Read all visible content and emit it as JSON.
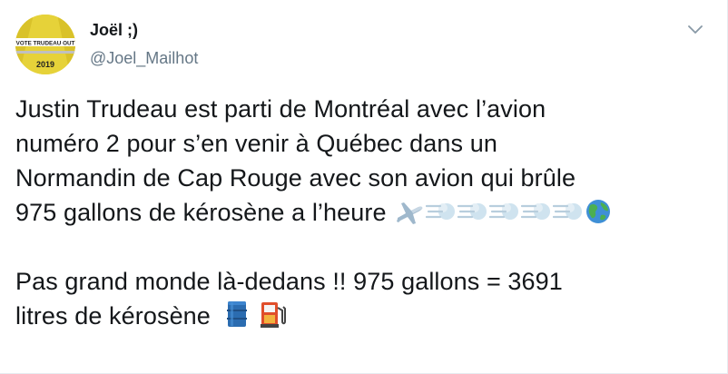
{
  "author": {
    "name": "Joël ;)",
    "handle": "@Joel_Mailhot",
    "avatar_badge_text": "VOTE TRUDEAU OUT",
    "avatar_year": "2019"
  },
  "menu": {
    "icon": "chevron-down-icon"
  },
  "tweet": {
    "paragraph1": [
      "Justin Trudeau est parti de Montréal avec l’avion",
      "numéro 2 pour s’en venir à Québec dans un",
      "Normandin de Cap Rouge avec son avion qui brûle",
      "975 gallons de kérosène a l’heure"
    ],
    "paragraph2": [
      "Pas grand monde là-dedans !! 975 gallons = 3691",
      "litres de kérosène"
    ],
    "emojis_line4": [
      "airplane-icon",
      "dash-icon",
      "dash-icon",
      "dash-icon",
      "dash-icon",
      "dash-icon",
      "globe-icon"
    ],
    "emojis_line6": [
      "oil-drum-icon",
      "fuel-pump-icon"
    ]
  },
  "colors": {
    "text": "#14171a",
    "secondary": "#657786",
    "border": "#e6ecf0",
    "avatar_yellow": "#e8d33a"
  }
}
